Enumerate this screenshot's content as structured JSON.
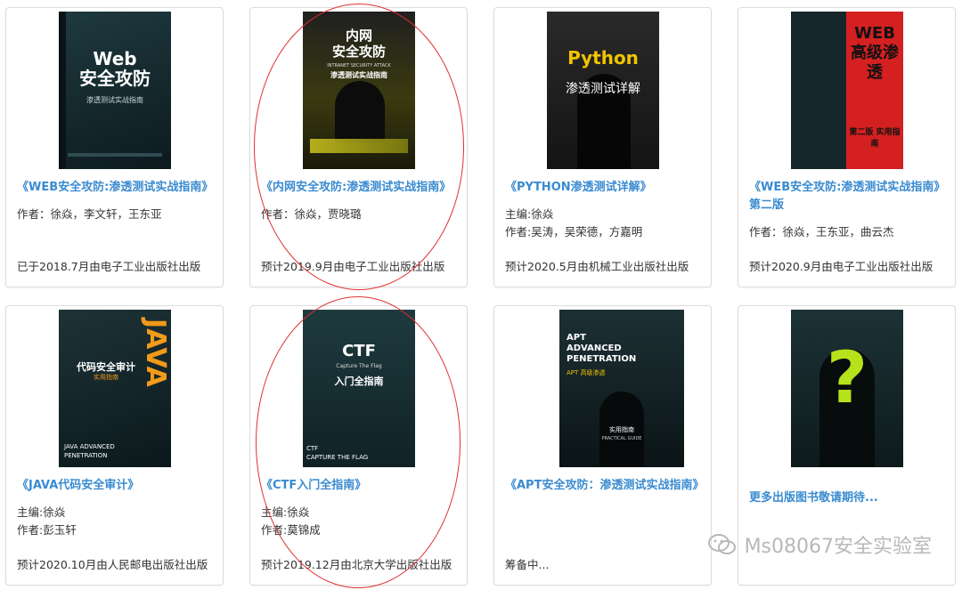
{
  "cards": [
    {
      "title": "《WEB安全攻防:渗透测试实战指南》",
      "meta1": "作者：徐焱，李文轩，王东亚",
      "meta2": "",
      "publish": "已于2018.7月由电子工业出版社出版",
      "cover_big": "Web\n安全攻防",
      "cover_sub": "渗透测试实战指南"
    },
    {
      "title": "《内网安全攻防:渗透测试实战指南》",
      "meta1": "作者：徐焱，贾晓璐",
      "meta2": "",
      "publish": "预计2019.9月由电子工业出版社出版",
      "cover_big": "内网\n安全攻防",
      "cover_sub": "INTRANET SECURITY ATTACK",
      "cover_sub2": "渗透测试实战指南"
    },
    {
      "title": "《PYTHON渗透测试详解》",
      "meta1": "主编:徐焱",
      "meta2": "作者:吴涛，吴荣德，方嘉明",
      "publish": "预计2020.5月由机械工业出版社出版",
      "cover_big": "Python",
      "cover_sub": "渗透测试详解"
    },
    {
      "title": "《WEB安全攻防:渗透测试实战指南》第二版",
      "meta1": "作者：徐焱，王东亚，曲云杰",
      "meta2": "",
      "publish": "预计2020.9月由电子工业出版社出版",
      "cover_big": "WEB\n高级渗透",
      "cover_sub": "第二版 实用指南"
    },
    {
      "title": "《JAVA代码安全审计》",
      "meta1": "主编:徐焱",
      "meta2": "作者:彭玉轩",
      "publish": "预计2020.10月由人民邮电出版社出版",
      "cover_big": "代码安全审计",
      "cover_sub": "实用指南",
      "cover_sub2": "JAVA ADVANCED PENETRATION",
      "cover_side": "JAVA"
    },
    {
      "title": "《CTF入门全指南》",
      "meta1": "主编:徐焱",
      "meta2": "作者:莫锦成",
      "publish": "预计2019.12月由北京大学出版社出版",
      "cover_big": "CTF",
      "cover_sub": "Capture The Flag",
      "cover_sub2": "入门全指南",
      "cover_foot": "CTF\nCAPTURE THE FLAG"
    },
    {
      "title": "《APT安全攻防：渗透测试实战指南》",
      "meta1": "",
      "meta2": "",
      "publish": "筹备中...",
      "cover_big": "APT\nADVANCED\nPENETRATION",
      "cover_sub": "APT 高级渗透",
      "cover_sub2": "实用指南",
      "cover_foot": "PRACTICAL GUIDE"
    },
    {
      "title": "更多出版图书敬请期待...",
      "meta1": "",
      "meta2": "",
      "publish": "",
      "cover_big": "?"
    }
  ],
  "watermark": "Ms08067安全实验室",
  "colors": {
    "title_blue": "#3a8bd0",
    "oval_red": "#e03030",
    "python_yellow": "#f2c400",
    "java_orange": "#f29a1a",
    "question_green": "#b5e21a",
    "web2_red": "#d42020"
  }
}
